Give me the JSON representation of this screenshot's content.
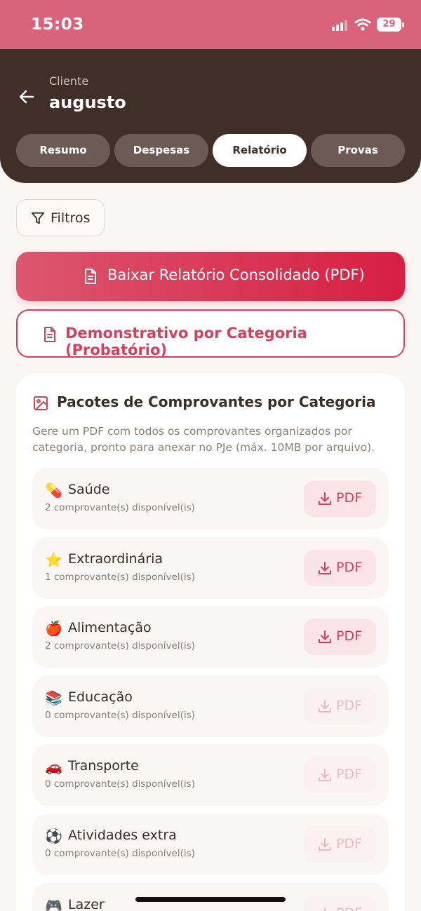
{
  "status": {
    "time": "15:03",
    "battery": "29"
  },
  "header": {
    "subtitle": "Cliente",
    "title": "augusto"
  },
  "tabs": [
    {
      "label": "Resumo"
    },
    {
      "label": "Despesas"
    },
    {
      "label": "Relatório"
    },
    {
      "label": "Provas"
    }
  ],
  "filter": {
    "label": "Filtros"
  },
  "actions": {
    "consolidated": "Baixar Relatório Consolidado (PDF)",
    "by_category": "Demonstrativo por Categoria (Probatório)"
  },
  "packages": {
    "title": "Pacotes de Comprovantes por Categoria",
    "description": "Gere um PDF com todos os comprovantes organizados por categoria, pronto para anexar no PJe (máx. 10MB por arquivo).",
    "pdf_label": "PDF",
    "categories": [
      {
        "emoji": "💊",
        "name": "Saúde",
        "count": "2 comprovante(s) disponível(is)"
      },
      {
        "emoji": "⭐",
        "name": "Extraordinária",
        "count": "1 comprovante(s) disponível(is)"
      },
      {
        "emoji": "🍎",
        "name": "Alimentação",
        "count": "2 comprovante(s) disponível(is)"
      },
      {
        "emoji": "📚",
        "name": "Educação",
        "count": "0 comprovante(s) disponível(is)"
      },
      {
        "emoji": "🚗",
        "name": "Transporte",
        "count": "0 comprovante(s) disponível(is)"
      },
      {
        "emoji": "⚽",
        "name": "Atividades extra",
        "count": "0 comprovante(s) disponível(is)"
      },
      {
        "emoji": "🎮",
        "name": "Lazer",
        "count": ""
      }
    ]
  },
  "colors": {
    "accent": "#d6405d",
    "header": "#3f2f28",
    "status_bar": "#d9637a"
  }
}
